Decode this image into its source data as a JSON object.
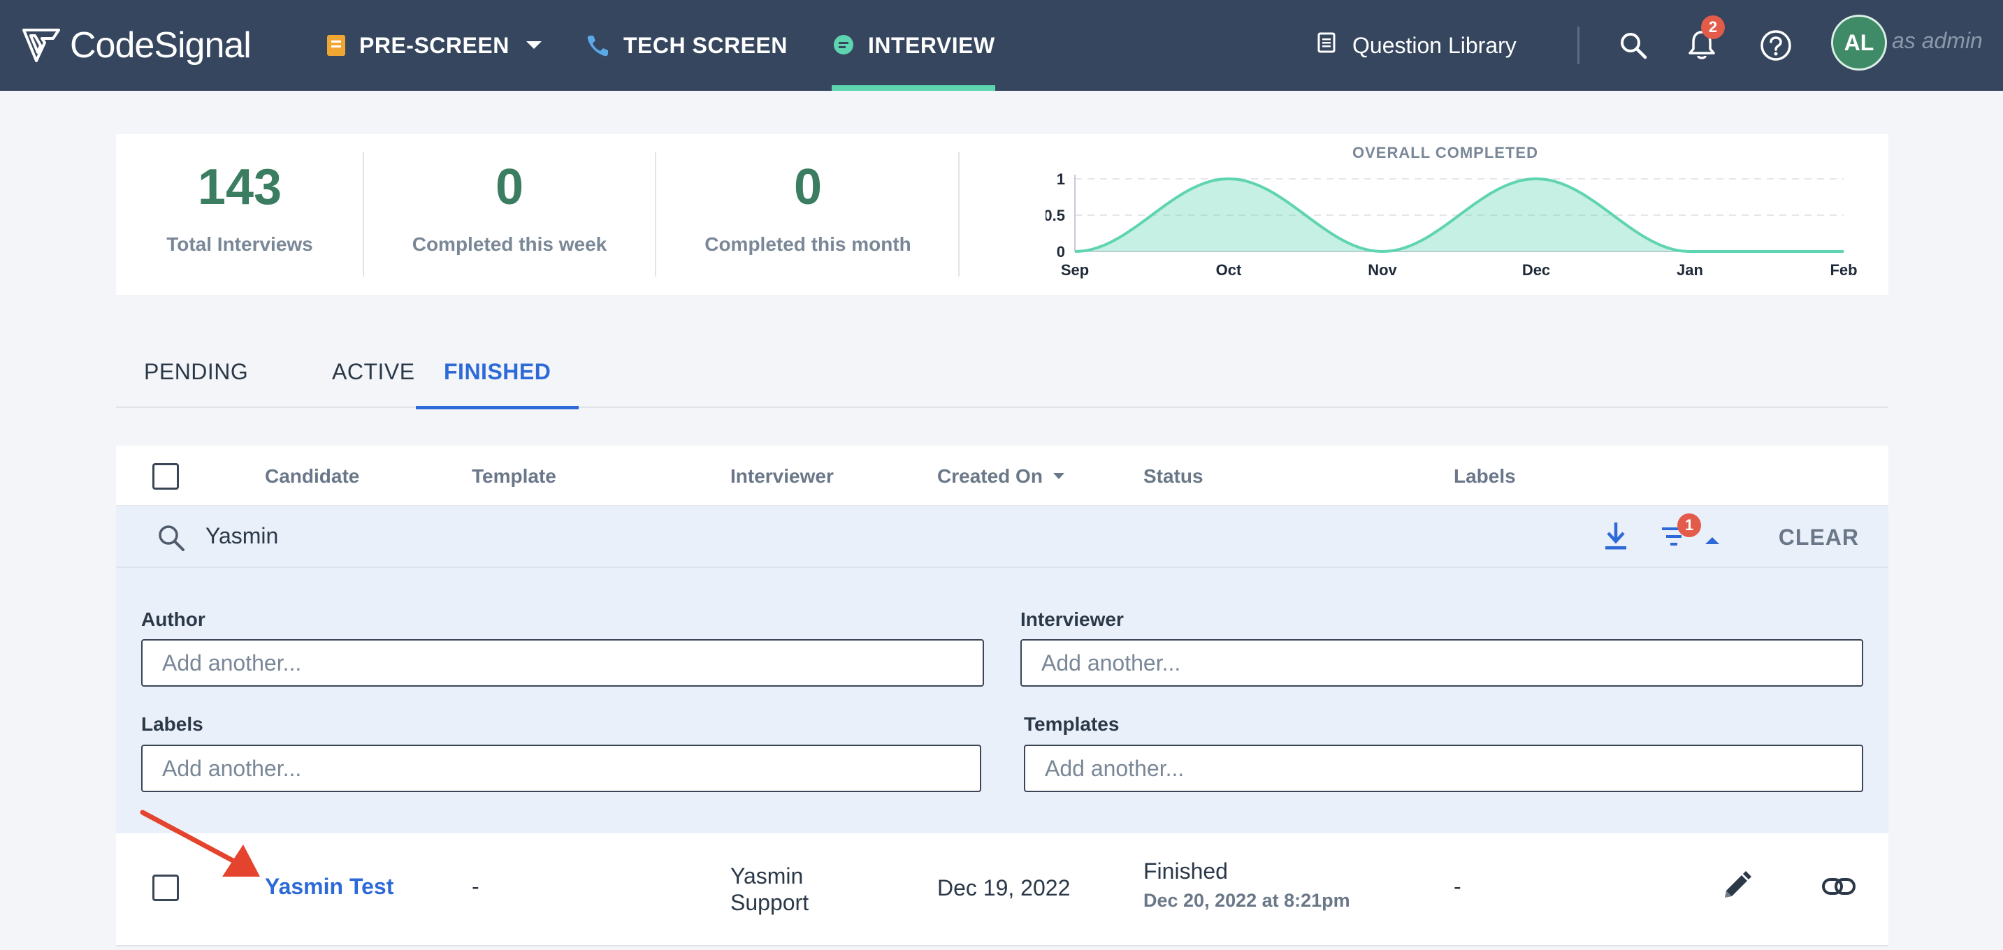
{
  "nav": {
    "logo": "CodeSignal",
    "tabs": [
      {
        "label": "PRE-SCREEN",
        "icon": "note-icon"
      },
      {
        "label": "TECH SCREEN",
        "icon": "phone-icon"
      },
      {
        "label": "INTERVIEW",
        "icon": "chat-icon"
      }
    ],
    "question_library": "Question Library",
    "notification_count": "2",
    "avatar_initials": "AL",
    "role": "as admin",
    "accent": "#5fd4b1"
  },
  "stats": [
    {
      "value": "143",
      "label": "Total Interviews"
    },
    {
      "value": "0",
      "label": "Completed this week"
    },
    {
      "value": "0",
      "label": "Completed this month"
    }
  ],
  "chart_data": {
    "type": "area",
    "title": "OVERALL COMPLETED",
    "x": [
      "Sep",
      "Oct",
      "Nov",
      "Dec",
      "Jan",
      "Feb"
    ],
    "series": [
      {
        "values": [
          0,
          1,
          0,
          1,
          0,
          0
        ]
      }
    ],
    "yticks": [
      "0",
      "0.5",
      "1"
    ],
    "ylim": [
      0,
      1
    ],
    "grid": true,
    "color": "#5fd4b1"
  },
  "tabs": [
    {
      "label": "PENDING"
    },
    {
      "label": "ACTIVE"
    },
    {
      "label": "FINISHED"
    }
  ],
  "table": {
    "headers": {
      "candidate": "Candidate",
      "template": "Template",
      "interviewer": "Interviewer",
      "created_on": "Created On",
      "status": "Status",
      "labels": "Labels"
    },
    "search_value": "Yasmin",
    "filter_count": "1",
    "clear_label": "CLEAR",
    "filters": {
      "author_label": "Author",
      "interviewer_label": "Interviewer",
      "labels_label": "Labels",
      "templates_label": "Templates",
      "placeholder": "Add another..."
    },
    "rows": [
      {
        "candidate": "Yasmin Test",
        "template": "-",
        "interviewer_line1": "Yasmin",
        "interviewer_line2": "Support",
        "created_on": "Dec 19, 2022",
        "status": "Finished",
        "status_date": "Dec 20, 2022 at 8:21pm",
        "labels": "-"
      }
    ]
  }
}
